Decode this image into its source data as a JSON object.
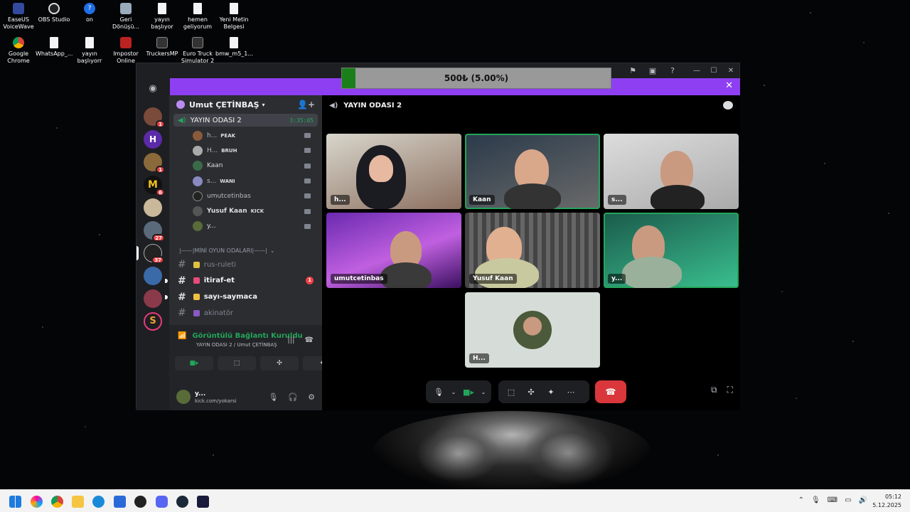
{
  "desktop": {
    "icons": [
      {
        "label": "EaseUS VoiceWave"
      },
      {
        "label": "OBS Studio"
      },
      {
        "label": "on"
      },
      {
        "label": "Geri Dönüşü..."
      },
      {
        "label": "yayın başlıyor"
      },
      {
        "label": "hemen geliyorum"
      },
      {
        "label": "Yeni Metin Belgesi"
      },
      {
        "label": "Google Chrome"
      },
      {
        "label": "WhatsApp_..."
      },
      {
        "label": "yayın başlıyorr"
      },
      {
        "label": "Impostor Online"
      },
      {
        "label": "TruckersMP"
      },
      {
        "label": "Euro Truck Simulator 2"
      },
      {
        "label": "bmw_m5_1..."
      }
    ]
  },
  "obs": {
    "progress_text": "500₺ (5.00%)",
    "progress_fraction": 0.05
  },
  "server_badges": [
    "1",
    "",
    "1",
    "6",
    "",
    "27",
    "37",
    "",
    "",
    ""
  ],
  "guild": {
    "name": "Umut ÇETİNBAŞ"
  },
  "voice_channel": {
    "name": "YAYIN ODASI 2",
    "timer": "3:35:05"
  },
  "members": [
    {
      "name": "h...",
      "status": "PEAK"
    },
    {
      "name": "H...",
      "status": "BRUH"
    },
    {
      "name": "Kaan",
      "status": ""
    },
    {
      "name": "s...",
      "status": "WANI"
    },
    {
      "name": "umutcetinbas",
      "status": ""
    },
    {
      "name": "Yusuf Kaan",
      "status": "KICK"
    },
    {
      "name": "y...",
      "status": ""
    }
  ],
  "category": "|——|MİNİ OYUN ODALARI|——|",
  "text_channels": [
    {
      "name": "rus-ruleti",
      "unread": false,
      "mentions": ""
    },
    {
      "name": "itiraf-et",
      "unread": true,
      "mentions": "1"
    },
    {
      "name": "sayı-saymaca",
      "unread": true,
      "mentions": ""
    },
    {
      "name": "akinatör",
      "unread": false,
      "mentions": ""
    }
  ],
  "voice_panel": {
    "status": "Görüntülü Bağlantı Kuruldu",
    "subtitle": "YAYIN ODASI 2 / Umut ÇETİNBAŞ"
  },
  "user": {
    "name": "y...",
    "status": "kick.com/yokarsi"
  },
  "main": {
    "title": "YAYIN ODASI 2",
    "tiles": [
      {
        "name": "h...",
        "speaking": false
      },
      {
        "name": "Kaan",
        "speaking": true
      },
      {
        "name": "s...",
        "speaking": false
      },
      {
        "name": "umutcetinbas",
        "speaking": false
      },
      {
        "name": "Yusuf Kaan",
        "speaking": false
      },
      {
        "name": "y...",
        "speaking": true
      },
      {
        "name": "H...",
        "speaking": false
      }
    ]
  },
  "taskbar": {
    "time": "05:12",
    "date": "5.12.2025"
  },
  "colors": {
    "accent_green": "#23a55a",
    "banner_purple": "#8f3ff2",
    "leave_red": "#da373c"
  }
}
